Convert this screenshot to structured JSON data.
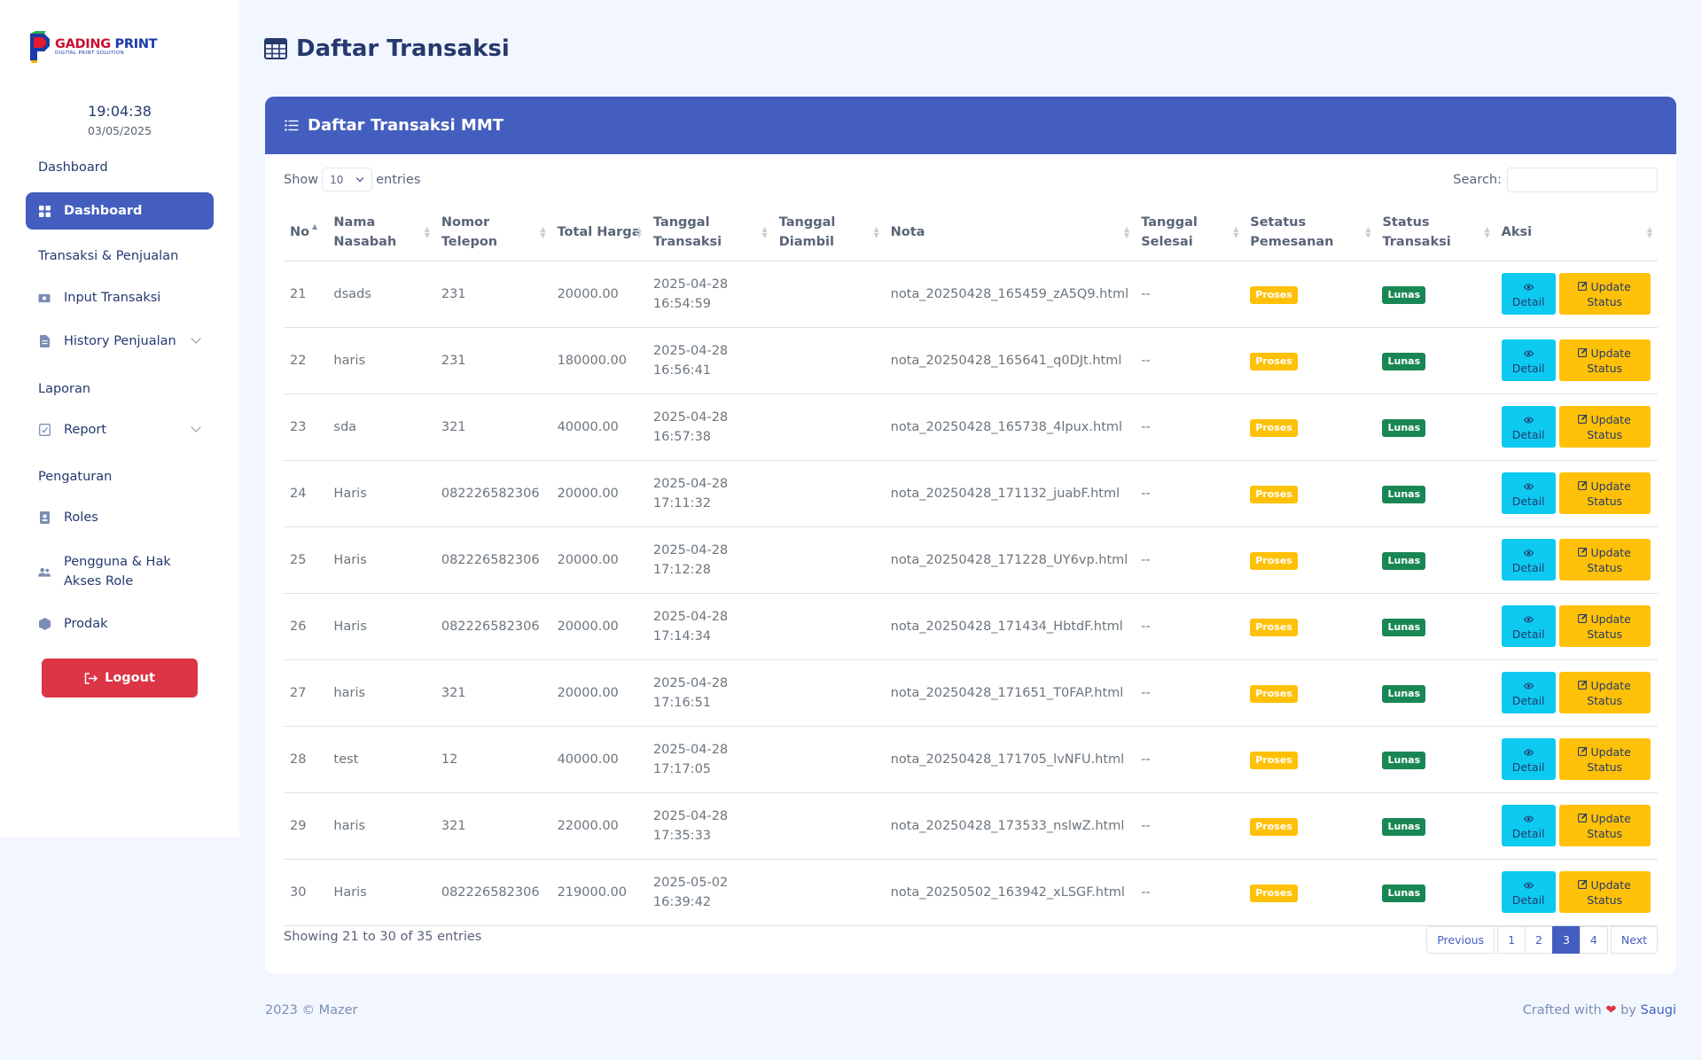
{
  "brand": {
    "logo_main_a": "GADING",
    "logo_main_b": " PRINT",
    "logo_sub": "DIGITAL PRINT SOLUTION"
  },
  "clock": {
    "time": "19:04:38",
    "date": "03/05/2025"
  },
  "sidebar": {
    "sections": [
      "Dashboard",
      "Transaksi & Penjualan",
      "Laporan",
      "Pengaturan"
    ],
    "items": [
      {
        "label": "Dashboard",
        "icon": "grid-icon",
        "active": true
      },
      {
        "label": "Input Transaksi",
        "icon": "cash-icon"
      },
      {
        "label": "History Penjualan",
        "icon": "document-icon"
      },
      {
        "label": "Report",
        "icon": "checklist-icon"
      },
      {
        "label": "Roles",
        "icon": "badge-icon"
      },
      {
        "label": "Pengguna & Hak Akses Role",
        "icon": "people-icon"
      },
      {
        "label": "Prodak",
        "icon": "hexagon-icon"
      }
    ],
    "logout": "Logout"
  },
  "page": {
    "title": "Daftar Transaksi"
  },
  "card": {
    "title": "Daftar Transaksi MMT"
  },
  "controls": {
    "show_label": "Show",
    "entries_value": "10",
    "entries_label": "entries",
    "search_label": "Search:"
  },
  "table": {
    "headers": [
      "No",
      "Nama Nasabah",
      "Nomor Telepon",
      "Total Harga",
      "Tanggal Transaksi",
      "Tanggal Diambil",
      "Nota",
      "Tanggal Selesai",
      "Setatus Pemesanan",
      "Status Transaksi",
      "Aksi"
    ],
    "rows": [
      {
        "no": "21",
        "nama": "dsads",
        "telp": "231",
        "total": "20000.00",
        "tgl_date": "2025-04-28",
        "tgl_time": "16:54:59",
        "diambil": "",
        "nota": "nota_20250428_165459_zA5Q9.html",
        "selesai": "--",
        "status_pesan": "Proses",
        "status_trx": "Lunas"
      },
      {
        "no": "22",
        "nama": "haris",
        "telp": "231",
        "total": "180000.00",
        "tgl_date": "2025-04-28",
        "tgl_time": "16:56:41",
        "diambil": "",
        "nota": "nota_20250428_165641_q0DJt.html",
        "selesai": "--",
        "status_pesan": "Proses",
        "status_trx": "Lunas"
      },
      {
        "no": "23",
        "nama": "sda",
        "telp": "321",
        "total": "40000.00",
        "tgl_date": "2025-04-28",
        "tgl_time": "16:57:38",
        "diambil": "",
        "nota": "nota_20250428_165738_4lpux.html",
        "selesai": "--",
        "status_pesan": "Proses",
        "status_trx": "Lunas"
      },
      {
        "no": "24",
        "nama": "Haris",
        "telp": "082226582306",
        "total": "20000.00",
        "tgl_date": "2025-04-28",
        "tgl_time": "17:11:32",
        "diambil": "",
        "nota": "nota_20250428_171132_juabF.html",
        "selesai": "--",
        "status_pesan": "Proses",
        "status_trx": "Lunas"
      },
      {
        "no": "25",
        "nama": "Haris",
        "telp": "082226582306",
        "total": "20000.00",
        "tgl_date": "2025-04-28",
        "tgl_time": "17:12:28",
        "diambil": "",
        "nota": "nota_20250428_171228_UY6vp.html",
        "selesai": "--",
        "status_pesan": "Proses",
        "status_trx": "Lunas"
      },
      {
        "no": "26",
        "nama": "Haris",
        "telp": "082226582306",
        "total": "20000.00",
        "tgl_date": "2025-04-28",
        "tgl_time": "17:14:34",
        "diambil": "",
        "nota": "nota_20250428_171434_HbtdF.html",
        "selesai": "--",
        "status_pesan": "Proses",
        "status_trx": "Lunas"
      },
      {
        "no": "27",
        "nama": "haris",
        "telp": "321",
        "total": "20000.00",
        "tgl_date": "2025-04-28",
        "tgl_time": "17:16:51",
        "diambil": "",
        "nota": "nota_20250428_171651_T0FAP.html",
        "selesai": "--",
        "status_pesan": "Proses",
        "status_trx": "Lunas"
      },
      {
        "no": "28",
        "nama": "test",
        "telp": "12",
        "total": "40000.00",
        "tgl_date": "2025-04-28",
        "tgl_time": "17:17:05",
        "diambil": "",
        "nota": "nota_20250428_171705_lvNFU.html",
        "selesai": "--",
        "status_pesan": "Proses",
        "status_trx": "Lunas"
      },
      {
        "no": "29",
        "nama": "haris",
        "telp": "321",
        "total": "22000.00",
        "tgl_date": "2025-04-28",
        "tgl_time": "17:35:33",
        "diambil": "",
        "nota": "nota_20250428_173533_nslwZ.html",
        "selesai": "--",
        "status_pesan": "Proses",
        "status_trx": "Lunas"
      },
      {
        "no": "30",
        "nama": "Haris",
        "telp": "082226582306",
        "total": "219000.00",
        "tgl_date": "2025-05-02",
        "tgl_time": "16:39:42",
        "diambil": "",
        "nota": "nota_20250502_163942_xLSGF.html",
        "selesai": "--",
        "status_pesan": "Proses",
        "status_trx": "Lunas"
      }
    ],
    "btn_detail": "Detail",
    "btn_update_a": "Update",
    "btn_update_b": "Status"
  },
  "info": "Showing 21 to 30 of 35 entries",
  "pagination": {
    "previous": "Previous",
    "pages": [
      "1",
      "2",
      "3",
      "4"
    ],
    "active": "3",
    "next": "Next"
  },
  "footer": {
    "left": "2023 © Mazer",
    "crafted": "Crafted with",
    "by": "by",
    "author": "Saugi"
  },
  "colors": {
    "primary": "#435ebe",
    "danger": "#dc3545",
    "warning": "#ffc107",
    "success": "#198754",
    "info": "#0dcaf0"
  }
}
